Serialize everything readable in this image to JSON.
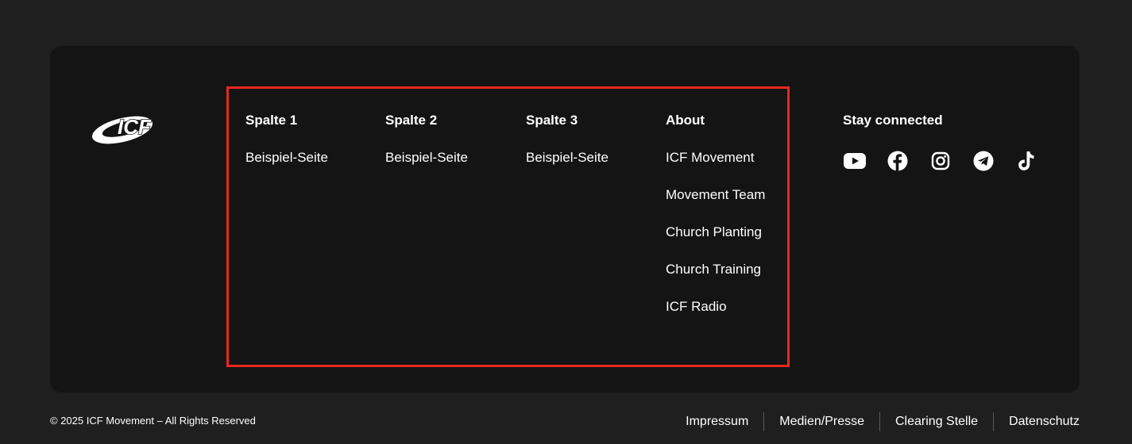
{
  "footer": {
    "logo_text": "ICF",
    "columns": [
      {
        "title": "Spalte 1",
        "links": [
          "Beispiel-Seite"
        ]
      },
      {
        "title": "Spalte 2",
        "links": [
          "Beispiel-Seite"
        ]
      },
      {
        "title": "Spalte 3",
        "links": [
          "Beispiel-Seite"
        ]
      },
      {
        "title": "About",
        "links": [
          "ICF Movement",
          "Movement Team",
          "Church Planting",
          "Church Training",
          "ICF Radio"
        ]
      }
    ],
    "social": {
      "title": "Stay connected",
      "icons": [
        "youtube-icon",
        "facebook-icon",
        "instagram-icon",
        "telegram-icon",
        "tiktok-icon"
      ]
    },
    "highlight_color": "#e8281c"
  },
  "bottom": {
    "copyright": "© 2025 ICF Movement – All Rights Reserved",
    "links": [
      "Impressum",
      "Medien/Presse",
      "Clearing Stelle",
      "Datenschutz"
    ]
  }
}
